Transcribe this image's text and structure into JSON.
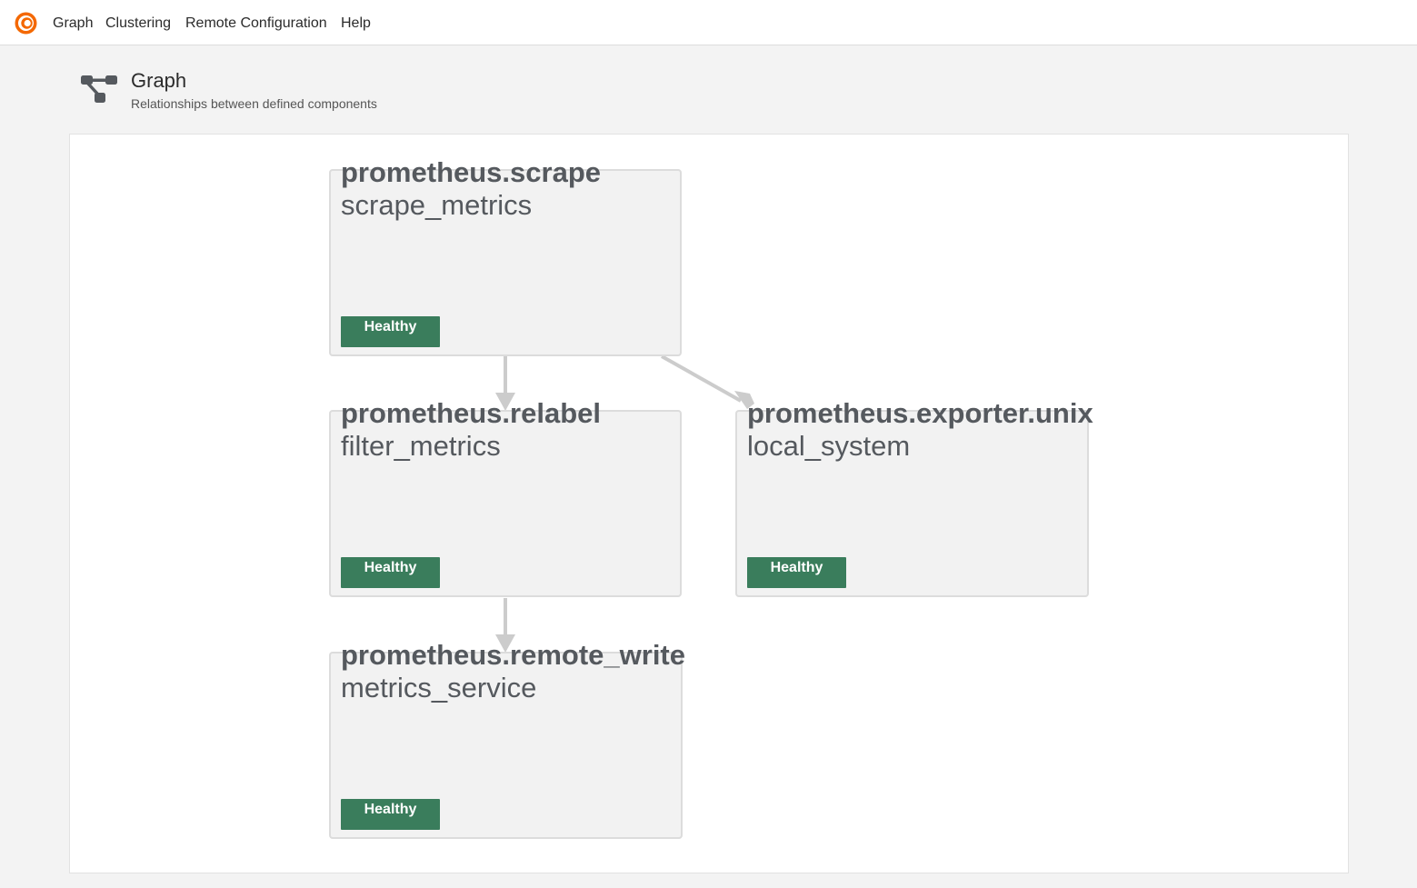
{
  "nav": {
    "items": [
      {
        "label": "Graph"
      },
      {
        "label": "Clustering"
      },
      {
        "label": "Remote Configuration"
      },
      {
        "label": "Help"
      }
    ]
  },
  "page": {
    "title": "Graph",
    "subtitle": "Relationships between defined components",
    "icon": "graph-icon"
  },
  "colors": {
    "healthy": "#3a7d5c",
    "accent": "#f46800",
    "edge": "#cccccc"
  },
  "nodes": [
    {
      "type": "prometheus.scrape",
      "label": "scrape_metrics",
      "health": "Healthy"
    },
    {
      "type": "prometheus.relabel",
      "label": "filter_metrics",
      "health": "Healthy"
    },
    {
      "type": "prometheus.exporter.unix",
      "label": "local_system",
      "health": "Healthy"
    },
    {
      "type": "prometheus.remote_write",
      "label": "metrics_service",
      "health": "Healthy"
    }
  ],
  "edges": [
    {
      "from": "prometheus.scrape",
      "to": "prometheus.relabel"
    },
    {
      "from": "prometheus.scrape",
      "to": "prometheus.exporter.unix"
    },
    {
      "from": "prometheus.relabel",
      "to": "prometheus.remote_write"
    }
  ]
}
